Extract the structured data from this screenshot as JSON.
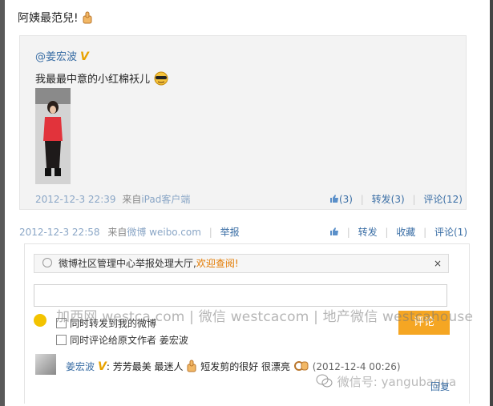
{
  "post": {
    "text": "阿姨最范兒!"
  },
  "quote": {
    "author": "@姜宏波",
    "verified_badge": "V",
    "text": "我最最中意的小红棉袄儿",
    "time": "2012-12-3 22:39",
    "source_prefix": "来自",
    "source": "iPad客户端",
    "like": "(3)",
    "repost": "转发(3)",
    "comment": "评论(12)"
  },
  "meta": {
    "time": "2012-12-3 22:58",
    "source_prefix": "来自",
    "source": "微博 weibo.com",
    "report": "举报",
    "repost": "转发",
    "favorite": "收藏",
    "comment": "评论(1)"
  },
  "comment_panel": {
    "notice_text": "微博社区管理中心举报处理大厅,",
    "notice_link": "欢迎查阅!",
    "notice_close": "×",
    "input_value": "",
    "checkbox_repost": "同时转发到我的微博",
    "checkbox_comment": "同时评论给原文作者 姜宏波",
    "submit_label": "评论",
    "watermark": "加西网 westca.com | 微信 westcacom | 地产微信 westcahouse"
  },
  "reply": {
    "author": "姜宏波",
    "verified_badge": "V",
    "colon": ":",
    "text_a": "芳芳最美 最迷人",
    "text_b": "短发剪的很好 很漂亮",
    "time": "(2012-12-4 00:26)",
    "reply_label": "回复"
  },
  "watermark2": "微信号: yangubagua",
  "colors": {
    "link_blue": "#3a6ea5",
    "submit_orange": "#f5a623",
    "notice_link_orange": "#e37a00",
    "verified_gold": "#e8a200"
  }
}
